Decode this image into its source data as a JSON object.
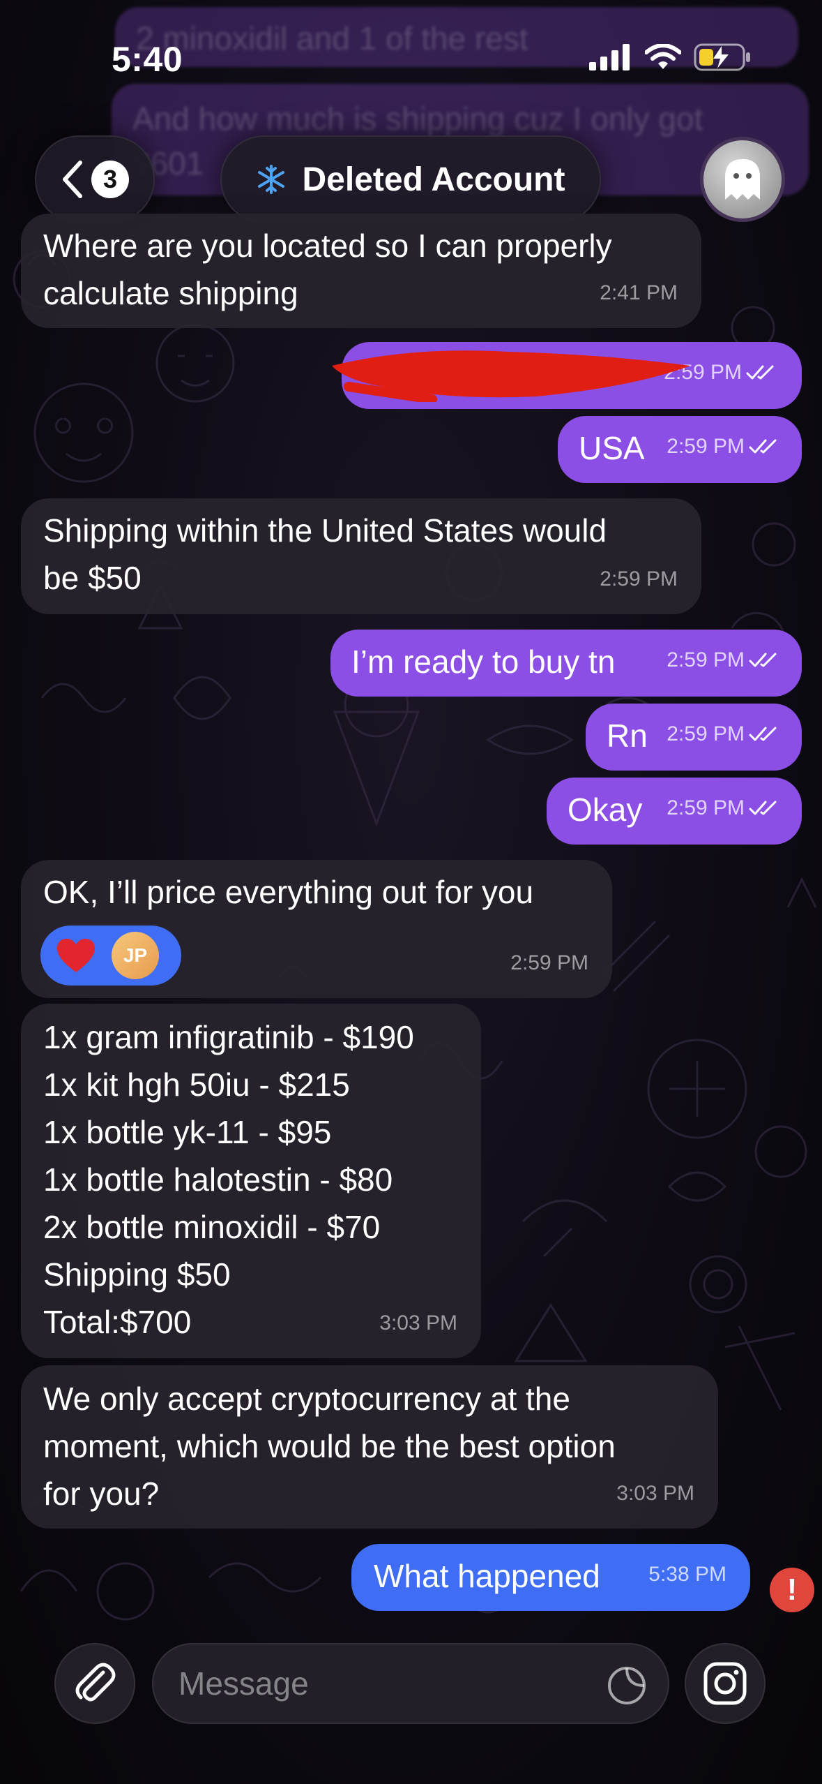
{
  "status_bar": {
    "time": "5:40"
  },
  "background_messages": [
    "2 minoxidil and 1 of the rest",
    "And how much is shipping cuz I only got",
    "$601"
  ],
  "header": {
    "back_count": "3",
    "title": "Deleted Account",
    "title_icon": "snowflake-icon",
    "avatar_icon": "ghost-icon"
  },
  "messages": [
    {
      "direction": "in",
      "lines": [
        "Where are you located so I can properly",
        "calculate shipping"
      ],
      "time": "2:41 PM"
    },
    {
      "direction": "out",
      "lines": [
        "[redacted]"
      ],
      "time": "2:59 PM",
      "redacted": true
    },
    {
      "direction": "out",
      "lines": [
        "USA"
      ],
      "time": "2:59 PM"
    },
    {
      "direction": "in",
      "lines": [
        "Shipping within the United States would",
        "be $50"
      ],
      "time": "2:59 PM"
    },
    {
      "direction": "out",
      "lines": [
        "I’m ready to buy tn"
      ],
      "time": "2:59 PM"
    },
    {
      "direction": "out",
      "lines": [
        "Rn"
      ],
      "time": "2:59 PM"
    },
    {
      "direction": "out",
      "lines": [
        "Okay"
      ],
      "time": "2:59 PM"
    },
    {
      "direction": "in",
      "lines": [
        "OK, I’ll price everything out for you"
      ],
      "time": "2:59 PM",
      "reaction": {
        "emoji": "❤️",
        "initials": "JP"
      }
    },
    {
      "direction": "in",
      "lines": [
        "1x gram infigratinib - $190",
        "1x kit hgh 50iu - $215",
        "1x bottle yk-11 - $95",
        "1x bottle halotestin - $80",
        "2x bottle minoxidil - $70",
        "Shipping $50",
        "Total:$700"
      ],
      "time": "3:03 PM"
    },
    {
      "direction": "in",
      "lines": [
        "We only accept cryptocurrency at the",
        "moment, which would be the best option",
        "for you?"
      ],
      "time": "3:03 PM"
    },
    {
      "direction": "out",
      "lines": [
        "What happened"
      ],
      "time": "5:38 PM",
      "status": "failed"
    }
  ],
  "input_bar": {
    "placeholder": "Message",
    "attach_icon": "paperclip-icon",
    "sticker_icon": "sticker-icon",
    "camera_icon": "instagram-camera-icon"
  },
  "colors": {
    "outgoing_bubble": "#8b4fe6",
    "outgoing_failed_bubble": "#3f6ef4",
    "incoming_bubble": "#28242e",
    "error": "#e0463c",
    "redaction": "#e01e12"
  }
}
